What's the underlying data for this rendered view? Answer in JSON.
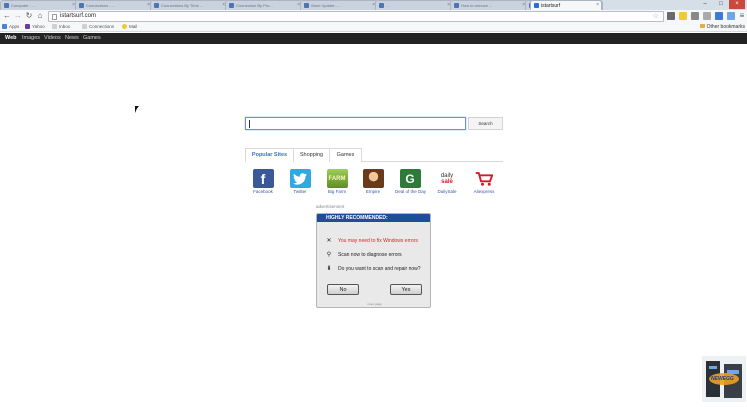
{
  "browser": {
    "tabs": [
      {
        "label": "Computer - ...",
        "active": false
      },
      {
        "label": "Connections - ...",
        "active": false
      },
      {
        "label": "Connections By Time ...",
        "active": false
      },
      {
        "label": "Connection By Pro...",
        "active": false
      },
      {
        "label": "Store Update - ...",
        "active": false
      },
      {
        "label": "...",
        "active": false
      },
      {
        "label": "How to remove ...",
        "active": false
      },
      {
        "label": "...",
        "active": false
      },
      {
        "label": "istartsurf",
        "active": true
      }
    ],
    "address": "istartsurf.com",
    "bookmarks": [
      "Apps",
      "Yahoo",
      "Inbox",
      "Connections",
      "Mail"
    ],
    "other_bookmarks": "Other bookmarks"
  },
  "nav": {
    "links": [
      "Web",
      "Images",
      "Videos",
      "News",
      "Games"
    ]
  },
  "search": {
    "value": "",
    "button": "Search"
  },
  "popular": {
    "tabs": [
      "Popular Sites",
      "Shopping",
      "Games"
    ],
    "sites": [
      {
        "label": "Facebook",
        "icon": "facebook-icon",
        "color": "#3b5998"
      },
      {
        "label": "Twitter",
        "icon": "twitter-icon",
        "color": "#2fa9e0"
      },
      {
        "label": "Big Farm",
        "icon": "bigfarm-icon",
        "color": "#6a9a2b"
      },
      {
        "label": "Empire",
        "icon": "empire-icon",
        "color": "#8c5a2b"
      },
      {
        "label": "Deal of the Day",
        "icon": "deal-icon",
        "color": "#2d7a3a"
      },
      {
        "label": "DailySale",
        "icon": "dailysale-icon",
        "color": "#333333"
      },
      {
        "label": "Aliexpress",
        "icon": "cart-icon",
        "color": "#d7192d"
      }
    ]
  },
  "ad": {
    "label": "advertisement",
    "header": "HIGHLY RECOMMENDED:",
    "rows": [
      {
        "text": "You may need to fix Windows errors",
        "icon": "tools-icon",
        "warning": true
      },
      {
        "text": "Scan now to diagnose errors",
        "icon": "magnifier-icon",
        "warning": false
      },
      {
        "text": "Do you want to scan and repair now?",
        "icon": "download-icon",
        "warning": false
      }
    ],
    "no": "No",
    "yes": "Yes",
    "footer": "more page"
  },
  "widget": {
    "brand": "NEWEGG"
  }
}
